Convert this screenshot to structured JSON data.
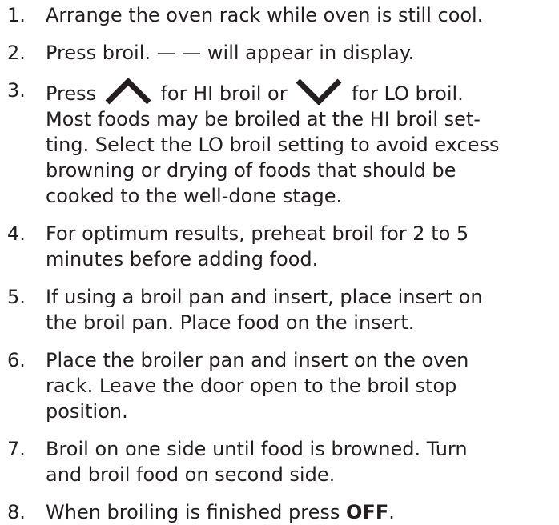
{
  "steps": [
    {
      "number": "1.",
      "lines": [
        "Arrange the oven rack while oven is still cool."
      ]
    },
    {
      "number": "2.",
      "lines": [
        "Press broil. — — will appear in display."
      ]
    },
    {
      "number": "3.",
      "line1": {
        "a": "Press",
        "b": "for HI broil or",
        "c": "for LO broil."
      },
      "up_icon": "chevron-up-icon",
      "down_icon": "chevron-down-icon",
      "lines": [
        "Most foods may be broiled at the HI broil set-",
        "ting. Select the LO broil setting to avoid excess",
        "browning or drying of foods that should be",
        "cooked to the well-done stage."
      ]
    },
    {
      "number": "4.",
      "lines": [
        "For optimum results, preheat broil for 2 to 5",
        "minutes before adding food."
      ]
    },
    {
      "number": "5.",
      "lines": [
        "If using a broil pan and insert, place insert on",
        "the broil pan. Place food on the insert."
      ]
    },
    {
      "number": "6.",
      "lines": [
        "Place the broiler pan and insert on the oven",
        "rack. Leave the door open to the broil stop",
        "position."
      ]
    },
    {
      "number": "7.",
      "lines": [
        "Broil on one side until food is browned. Turn",
        "and broil food on second side."
      ]
    },
    {
      "number": "8.",
      "text_before": "When broiling is finished press",
      "bold": "OFF",
      "text_after": "."
    }
  ]
}
